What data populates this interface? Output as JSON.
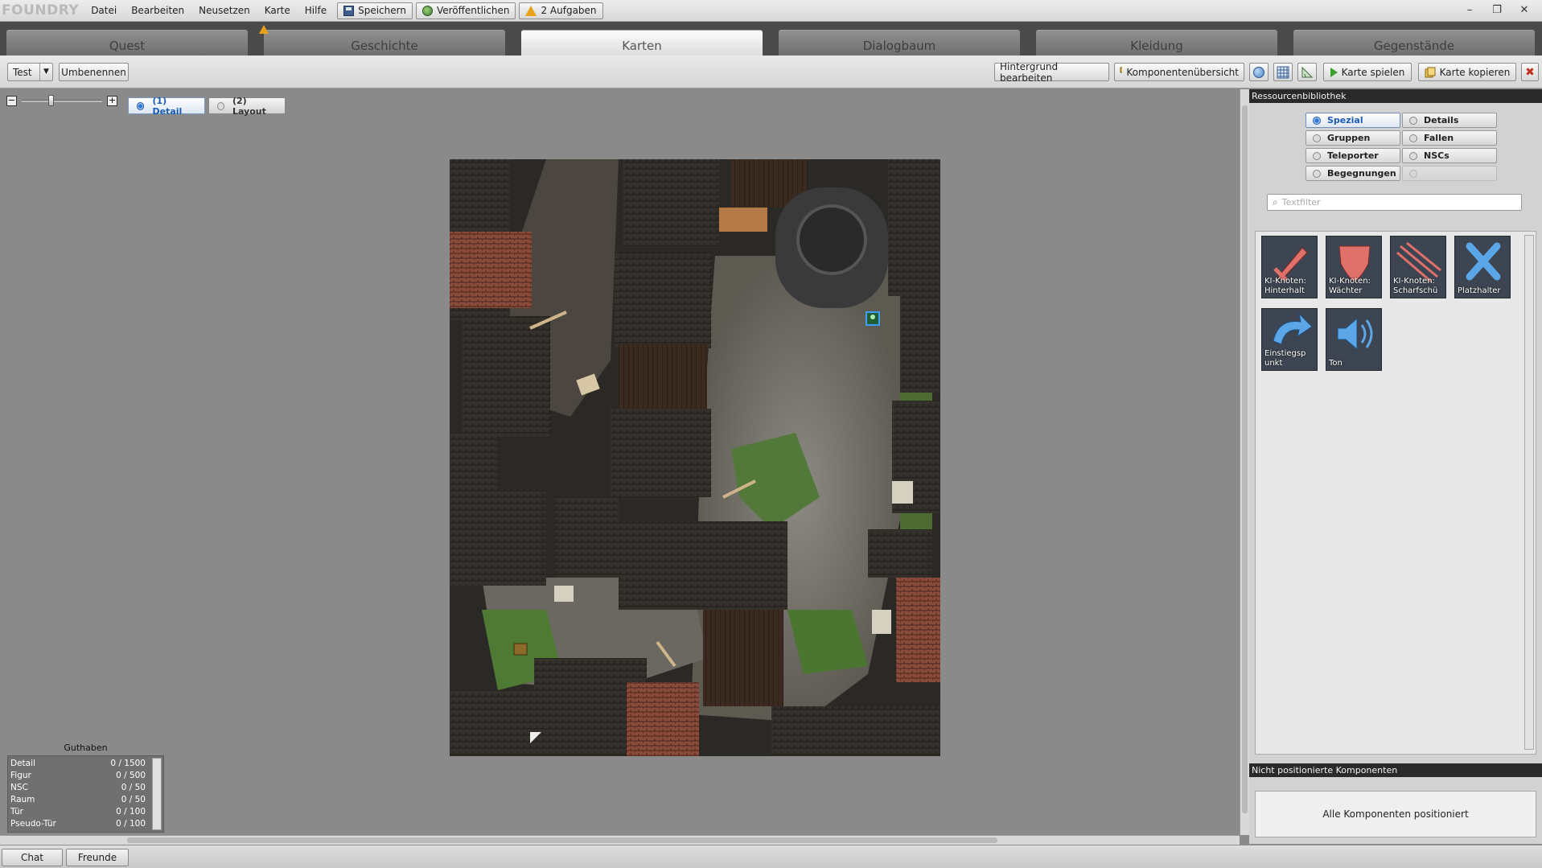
{
  "app": {
    "logo": "FOUNDRY",
    "menu": [
      "Datei",
      "Bearbeiten",
      "Neusetzen",
      "Karte",
      "Hilfe"
    ],
    "actions": {
      "save": "Speichern",
      "publish": "Veröffentlichen",
      "tasks": "2 Aufgaben"
    },
    "window": {
      "minimize": "–",
      "restore": "❐",
      "close": "✕"
    }
  },
  "tabs": [
    {
      "label": "Quest",
      "active": false
    },
    {
      "label": "Geschichte",
      "active": false,
      "warning": true
    },
    {
      "label": "Karten",
      "active": true
    },
    {
      "label": "Dialogbaum",
      "active": false
    },
    {
      "label": "Kleidung",
      "active": false
    },
    {
      "label": "Gegenstände",
      "active": false
    }
  ],
  "toolbar": {
    "map_select": "Test",
    "rename": "Umbenennen",
    "edit_background": "Hintergrund bearbeiten",
    "component_overview": "Komponentenübersicht",
    "play_map": "Karte spielen",
    "copy_map": "Karte kopieren"
  },
  "view": {
    "zoom_level": 0.35,
    "modes": [
      {
        "label": "(1) Detail",
        "active": true
      },
      {
        "label": "(2) Layout",
        "active": false
      }
    ]
  },
  "credits": {
    "title": "Guthaben",
    "rows": [
      {
        "name": "Detail",
        "value": "0 / 1500"
      },
      {
        "name": "Figur",
        "value": "0 / 500"
      },
      {
        "name": "NSC",
        "value": "0 / 50"
      },
      {
        "name": "Raum",
        "value": "0 / 50"
      },
      {
        "name": "Tür",
        "value": "0 / 100"
      },
      {
        "name": "Pseudo-Tür",
        "value": "0 / 100"
      }
    ]
  },
  "library": {
    "title": "Ressourcenbibliothek",
    "categories": [
      {
        "label": "Spezial",
        "active": true
      },
      {
        "label": "Details",
        "active": false
      },
      {
        "label": "Gruppen",
        "active": false
      },
      {
        "label": "Fallen",
        "active": false
      },
      {
        "label": "Teleporter",
        "active": false
      },
      {
        "label": "NSCs",
        "active": false
      },
      {
        "label": "Begegnungen",
        "active": false
      },
      {
        "label": "",
        "active": false,
        "disabled": true
      }
    ],
    "filter_placeholder": "Textfilter",
    "items": [
      {
        "label": "KI-Knoten:\nHinterhalt",
        "icon": "dagger-icon",
        "color": "#e0706a"
      },
      {
        "label": "KI-Knoten:\nWächter",
        "icon": "shield-icon",
        "color": "#e0706a"
      },
      {
        "label": "KI-Knoten:\nScharfschü",
        "icon": "arrows-icon",
        "color": "#e0706a"
      },
      {
        "label": "Platzhalter",
        "icon": "x-cross-icon",
        "color": "#5aa6e6"
      },
      {
        "label": "Einstiegsp\nunkt",
        "icon": "entry-arrow-icon",
        "color": "#5aa6e6"
      },
      {
        "label": "Ton",
        "icon": "speaker-icon",
        "color": "#5aa6e6"
      }
    ]
  },
  "unplaced": {
    "title": "Nicht positionierte Komponenten",
    "status": "Alle Komponenten positioniert"
  },
  "bottom": {
    "chat": "Chat",
    "friends": "Freunde"
  }
}
